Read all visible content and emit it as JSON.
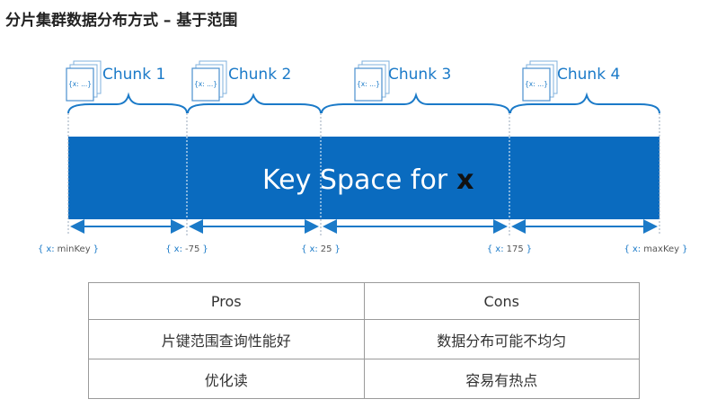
{
  "title": "分片集群数据分布方式 – 基于范围",
  "diagram": {
    "keyspace_label": "Key Space for",
    "keyspace_var": "x",
    "colors": {
      "band": "#0a6bbf",
      "accent": "#1b7ac8",
      "divider": "#ffffff"
    },
    "chunks": [
      {
        "label": "Chunk 1",
        "doc_text": "{x: ...}"
      },
      {
        "label": "Chunk 2",
        "doc_text": "{x: ...}"
      },
      {
        "label": "Chunk 3",
        "doc_text": "{x: ...}"
      },
      {
        "label": "Chunk 4",
        "doc_text": "{x: ...}"
      }
    ],
    "boundaries": [
      {
        "open": "{",
        "key": "x:",
        "value": "minKey",
        "close": "}"
      },
      {
        "open": "{",
        "key": "x:",
        "value": "-75",
        "close": "}"
      },
      {
        "open": "{",
        "key": "x:",
        "value": "25",
        "close": "}"
      },
      {
        "open": "{",
        "key": "x:",
        "value": "175",
        "close": "}"
      },
      {
        "open": "{",
        "key": "x:",
        "value": "maxKey",
        "close": "}"
      }
    ]
  },
  "table": {
    "headers": [
      "Pros",
      "Cons"
    ],
    "rows": [
      [
        "片键范围查询性能好",
        "数据分布可能不均匀"
      ],
      [
        "优化读",
        "容易有热点"
      ]
    ]
  }
}
